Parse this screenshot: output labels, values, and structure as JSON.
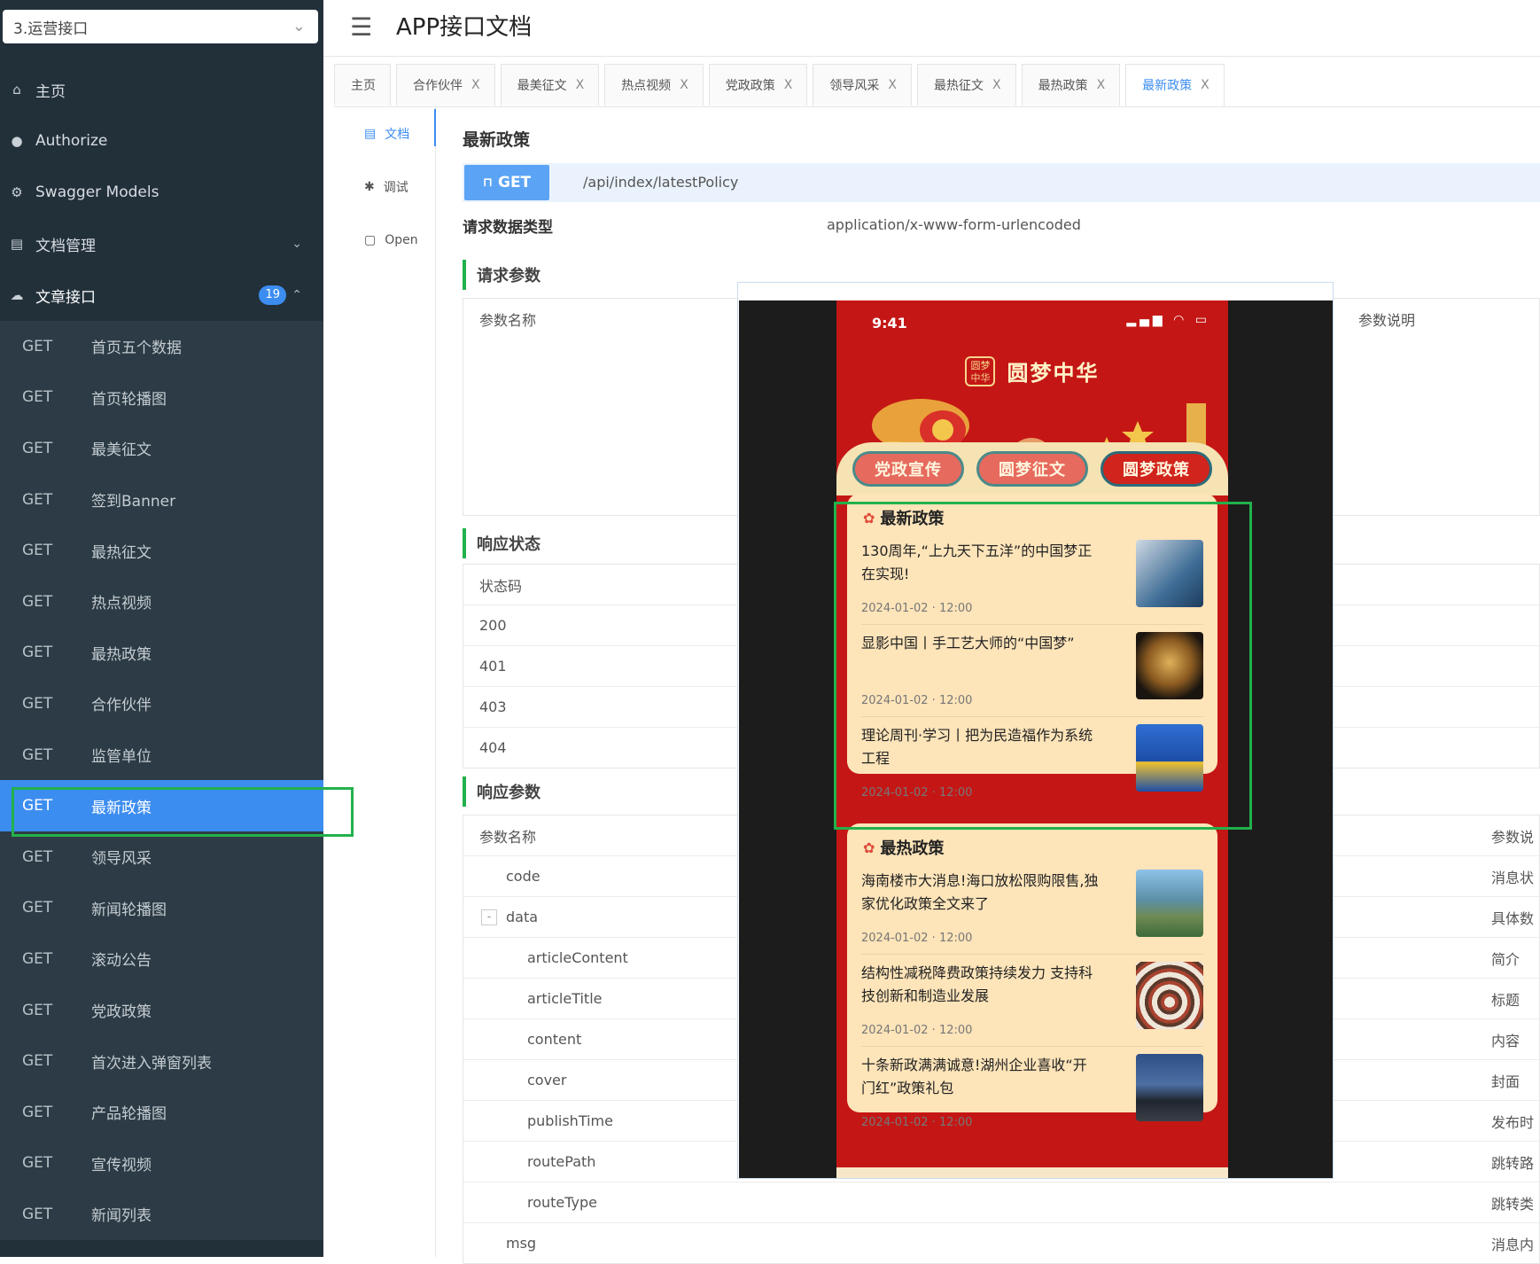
{
  "sidebar": {
    "group_select": "3.运营接口",
    "menu": [
      {
        "icon": "home-icon",
        "glyph": "⌂",
        "label": "主页"
      },
      {
        "icon": "lock-icon",
        "glyph": "🔒",
        "label": "Authorize"
      },
      {
        "icon": "gear-icon",
        "glyph": "⚙",
        "label": "Swagger Models"
      },
      {
        "icon": "doc-manage-icon",
        "glyph": "▤",
        "label": "文档管理"
      },
      {
        "icon": "cloud-icon",
        "glyph": "☁",
        "label": "文章接口",
        "badge": "19"
      }
    ],
    "apis": [
      {
        "method": "GET",
        "label": "首页五个数据"
      },
      {
        "method": "GET",
        "label": "首页轮播图"
      },
      {
        "method": "GET",
        "label": "最美征文"
      },
      {
        "method": "GET",
        "label": "签到Banner"
      },
      {
        "method": "GET",
        "label": "最热征文"
      },
      {
        "method": "GET",
        "label": "热点视频"
      },
      {
        "method": "GET",
        "label": "最热政策"
      },
      {
        "method": "GET",
        "label": "合作伙伴"
      },
      {
        "method": "GET",
        "label": "监管单位"
      },
      {
        "method": "GET",
        "label": "最新政策"
      },
      {
        "method": "GET",
        "label": "领导风采"
      },
      {
        "method": "GET",
        "label": "新闻轮播图"
      },
      {
        "method": "GET",
        "label": "滚动公告"
      },
      {
        "method": "GET",
        "label": "党政政策"
      },
      {
        "method": "GET",
        "label": "首次进入弹窗列表"
      },
      {
        "method": "GET",
        "label": "产品轮播图"
      },
      {
        "method": "GET",
        "label": "宣传视频"
      },
      {
        "method": "GET",
        "label": "新闻列表"
      }
    ]
  },
  "header": {
    "title": "APP接口文档"
  },
  "tabs": [
    "主页",
    "合作伙伴",
    "最美征文",
    "热点视频",
    "党政政策",
    "领导风采",
    "最热征文",
    "最热政策",
    "最新政策"
  ],
  "tab_close": "X",
  "subnav": [
    {
      "icon": "doc-icon",
      "glyph": "▤",
      "label": "文档"
    },
    {
      "icon": "bug-icon",
      "glyph": "✱",
      "label": "调试"
    },
    {
      "icon": "file-icon",
      "glyph": "▢",
      "label": "Open"
    }
  ],
  "doc": {
    "title": "最新政策",
    "method": "GET",
    "path": "/api/index/latestPolicy",
    "content_type_label": "请求数据类型",
    "content_type_value": "application/x-www-form-urlencoded",
    "req_params_title": "请求参数",
    "req_head_name": "参数名称",
    "req_head_desc": "参数说明",
    "resp_status_title": "响应状态",
    "status_head": "状态码",
    "status_codes": [
      "200",
      "401",
      "403",
      "404"
    ],
    "resp_params_title": "响应参数",
    "resp_head_name": "参数名称",
    "resp_head_desc": "参数说",
    "collapse_sign": "-",
    "resp_rows": [
      {
        "name": "code",
        "desc": "消息状"
      },
      {
        "name": "data",
        "desc": "具体数"
      },
      {
        "name": "articleContent",
        "desc": "简介"
      },
      {
        "name": "articleTitle",
        "desc": "标题"
      },
      {
        "name": "content",
        "desc": "内容"
      },
      {
        "name": "cover",
        "desc": "封面"
      },
      {
        "name": "publishTime",
        "desc": "发布时"
      },
      {
        "name": "routePath",
        "desc": "跳转路"
      },
      {
        "name": "routeType",
        "desc": "跳转类"
      },
      {
        "name": "msg",
        "desc": "消息内"
      }
    ]
  },
  "phone": {
    "time": "9:41",
    "status_icons": "▂▄▆ ◠ ▭",
    "logo_text": "圆梦中华",
    "brand": "圆梦中华",
    "pills": [
      "党政宣传",
      "圆梦征文",
      "圆梦政策"
    ],
    "latest": {
      "title": "最新政策",
      "items": [
        {
          "title": "130周年,“上九天下五洋”的中国梦正在实现!",
          "date": "2024-01-02 · 12:00"
        },
        {
          "title": "显影中国丨手工艺大师的“中国梦”",
          "date": "2024-01-02 · 12:00"
        },
        {
          "title": "理论周刊·学习丨把为民造福作为系统工程",
          "date": "2024-01-02 · 12:00"
        }
      ]
    },
    "hot": {
      "title": "最热政策",
      "items": [
        {
          "title": "海南楼市大消息!海口放松限购限售,独家优化政策全文来了",
          "date": "2024-01-02 · 12:00"
        },
        {
          "title": "结构性减税降费政策持续发力 支持科技创新和制造业发展",
          "date": "2024-01-02 · 12:00"
        },
        {
          "title": "十条新政满满诚意!湖州企业喜收“开门红”政策礼包",
          "date": "2024-01-02 · 12:00"
        }
      ]
    }
  },
  "colors": {
    "accent": "#3c8df0",
    "sidebar": "#22303a",
    "highlight_box": "#22b14c",
    "phone_red": "#c41715"
  }
}
